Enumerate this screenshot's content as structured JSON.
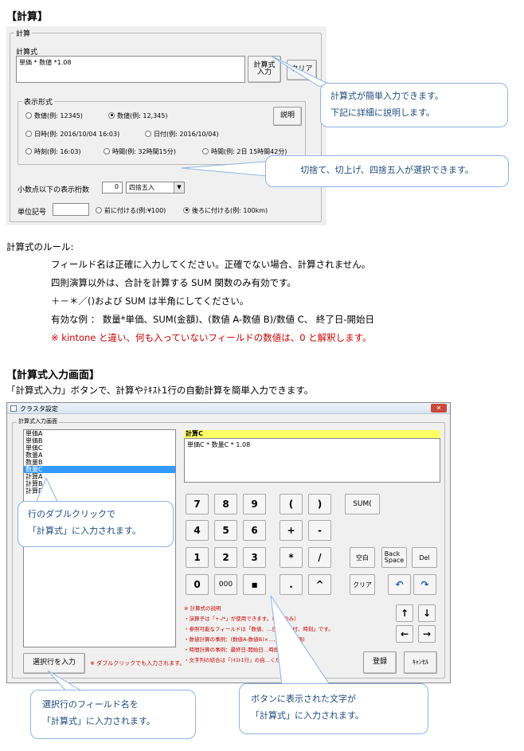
{
  "section1": {
    "heading": "【計算】",
    "window": {
      "group_label": "計算",
      "formula_label": "計算式",
      "formula_value": "単価 * 数値 *1.08",
      "formula_input_button": "計算式\n入力",
      "clear_button": "クリア",
      "format_group_label": "表示形式",
      "format_options": [
        {
          "label": "数値(例: 12345)",
          "selected": false
        },
        {
          "label": "数値(例: 12,345)",
          "selected": true
        },
        {
          "label": "日時(例: 2016/10/04 16:03)",
          "selected": false
        },
        {
          "label": "日付(例: 2016/10/04)",
          "selected": false
        },
        {
          "label": "時刻(例: 16:03)",
          "selected": false
        },
        {
          "label": "時間(例: 32時間15分)",
          "selected": false
        },
        {
          "label": "時間(例: 2日 15時間42分)",
          "selected": false
        }
      ],
      "explain_button": "説明",
      "decimal_label": "小数点以下の表示桁数",
      "decimal_value": "0",
      "rounding_value": "四捨五入",
      "unit_label": "単位記号",
      "unit_value": "",
      "unit_options": [
        {
          "label": "前に付ける(例:¥100)",
          "selected": false
        },
        {
          "label": "後ろに付ける(例: 100km)",
          "selected": true
        }
      ]
    },
    "callout1": [
      "計算式が簡単入力できます。",
      "下記に詳細に説明します。"
    ],
    "callout2": "切捨て、切上げ、四捨五入が選択できます。"
  },
  "rules": {
    "heading": "計算式のルール:",
    "lines": [
      "フィールド名は正確に入力してください。正確でない場合、計算されません。",
      "四則演算以外は、合計を計算する SUM 関数のみ有効です。",
      "＋－＊／()および SUM は半角にしてください。",
      "有効な例 ： 数量*単価、SUM(金額)、(数値 A-数値 B)/数値 C、 終了日-開始日"
    ],
    "note": "※ kintone と違い、何も入っていないフィールドの数値は、0 と解釈します。"
  },
  "section2": {
    "heading": "【計算式入力画面】",
    "description": "「計算式入力」ボタンで、計算やﾃｷｽﾄ1行の自動計算を簡単入力できます。",
    "window": {
      "title": "クラスタ設定",
      "group_label": "計算式入力画面",
      "fields": [
        "単価A",
        "単価B",
        "単価C",
        "数量A",
        "数量B",
        "数量C",
        "計算A",
        "計算B",
        "計算D"
      ],
      "selected_index": 5,
      "formula_title": "計算C",
      "formula_value": "単価C * 数量C * 1.08",
      "keys_row1": [
        "7",
        "8",
        "9",
        "(",
        ")",
        "SUM("
      ],
      "keys_row2": [
        "4",
        "5",
        "6",
        "+",
        "-"
      ],
      "keys_row3": [
        "1",
        "2",
        "3",
        "*",
        "/",
        "空白",
        "Back\nSpace",
        "Del"
      ],
      "keys_row4": [
        "0",
        "000",
        "■",
        ".",
        "^",
        "クリア"
      ],
      "notes_title": "※ 計算式の説明",
      "notes": [
        "・演算子は「+-/*」が使用できます。（※角のみ）",
        "・参照可能なフィールドは「数値、…日時、日付、時刻」です。",
        "・数値計算の事例：(数値A-数値B)×…、SUM(金額)",
        "・時間計算の事例：最終日-開始日…時間時間",
        "・文字列の結合は「ﾃｷｽﾄ1行」の自…ください。"
      ],
      "select_row_button": "選択行を入力",
      "double_click_note": "※ ダブルクリックでも入力されます。",
      "register_button": "登録",
      "cancel_button": "ｷｬﾝｾﾙ"
    },
    "callout_list": [
      "行のダブルクリックで",
      "「計算式」に入力されます。"
    ],
    "callout_select": [
      "選択行のフィールド名を",
      "「計算式」に入力されます。"
    ],
    "callout_buttons": [
      "ボタンに表示された文字が",
      "「計算式」に入力されます。"
    ]
  }
}
